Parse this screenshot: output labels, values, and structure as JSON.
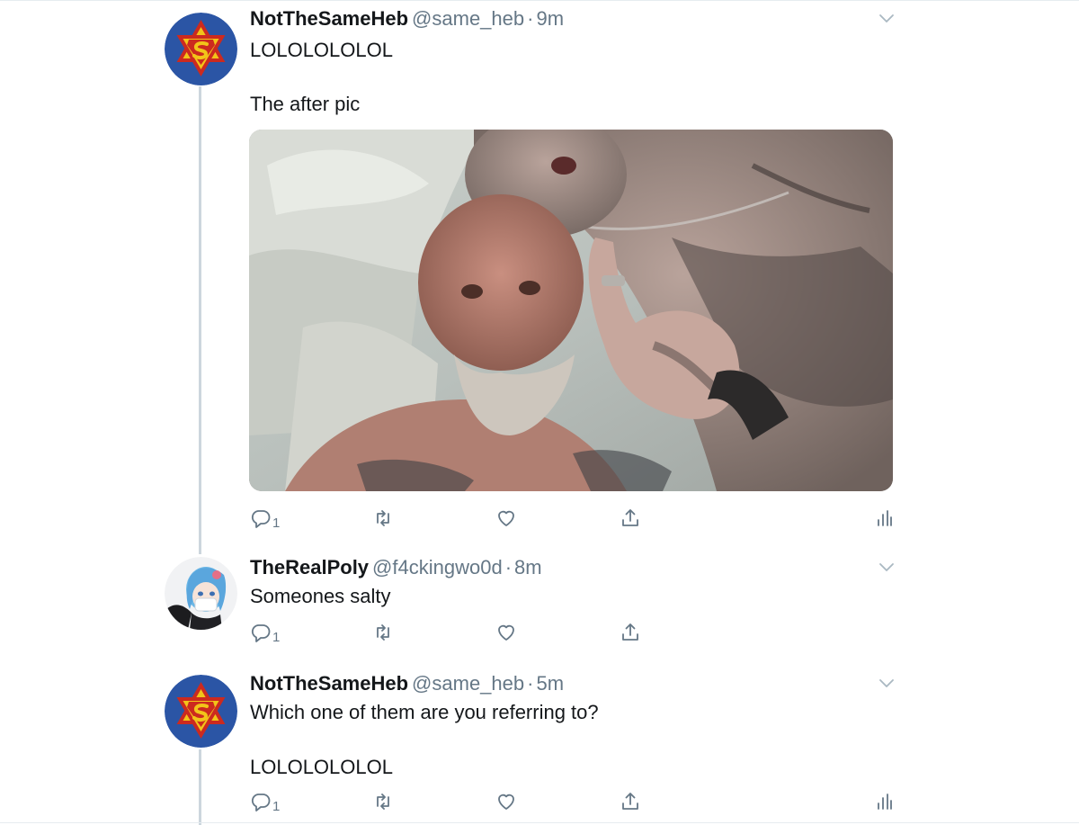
{
  "tweets": [
    {
      "display_name": "NotTheSameHeb",
      "handle": "@same_heb",
      "separator": "·",
      "time": "9m",
      "lines": [
        "LOLOLOLOLOL",
        "The after pic"
      ],
      "reply_count": "1",
      "avatar_icon": "superman-star-of-david-icon"
    },
    {
      "display_name": "TheRealPoly",
      "handle": "@f4ckingwo0d",
      "separator": "·",
      "time": "8m",
      "lines": [
        "Someones salty"
      ],
      "reply_count": "1",
      "avatar_icon": "anime-avatar"
    },
    {
      "display_name": "NotTheSameHeb",
      "handle": "@same_heb",
      "separator": "·",
      "time": "5m",
      "lines": [
        "Which one of them are you referring to?",
        "LOLOLOLOLOL"
      ],
      "reply_count": "1",
      "avatar_icon": "superman-star-of-david-icon"
    }
  ],
  "icons": {
    "reply": "reply-icon",
    "retweet": "retweet-icon",
    "like": "like-icon",
    "share": "share-icon",
    "analytics": "analytics-icon",
    "more": "chevron-down-icon"
  },
  "colors": {
    "text": "#14171a",
    "secondary": "#657786",
    "thread_line": "#ccd6dd",
    "divider": "#e6ecf0",
    "avatar_blue": "#2b55a5",
    "avatar_red": "#cc2a1f",
    "avatar_yellow": "#f2c419"
  }
}
